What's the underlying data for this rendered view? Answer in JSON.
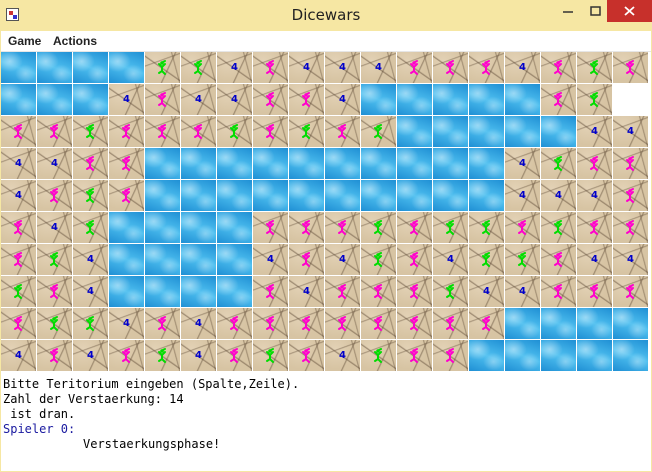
{
  "window": {
    "title": "Dicewars",
    "controls": {
      "minimize": "minimize-icon",
      "maximize": "maximize-icon",
      "close": "close-icon"
    }
  },
  "menu": {
    "items": [
      {
        "label": "Game"
      },
      {
        "label": "Actions"
      }
    ]
  },
  "board": {
    "columns": 18,
    "rows": 10,
    "legend": {
      "W": "water",
      "M": "magenta soldier",
      "G": "green soldier",
      "B": "blue 4"
    },
    "colors": {
      "magenta": "#ff00cc",
      "green": "#00dd00",
      "blue": "#0000cc",
      "water": "#29a6e6",
      "land": "#d7c4a3"
    },
    "blue_mark": "4",
    "grid": [
      "WWWWGGBMBBBMMMBMGM",
      "WWWBMBBMMBWWWWWMG",
      "MMGMMMGMGMGWWWWWBB",
      "BBMMWWWWWWWWWWBGMM",
      "BMGMWWWWWWWWWWBBBM",
      "MBGWWWWMMMGMGGMGMM",
      "MGBWWWWBMBGMBGGMBB",
      "GMBWWWWMBMMMGBBMMM",
      "MGGBMBMMMMMMMMWWWW",
      "BMBMGBMGMBGMMWWWWW"
    ]
  },
  "info": {
    "line1": "Bitte Teritorium eingeben (Spalte,Zeile).",
    "line2": "Zahl der Verstaerkung: 14",
    "line3": " ist dran.",
    "line4": "Spieler 0:",
    "line5": "Verstaerkungsphase!"
  }
}
